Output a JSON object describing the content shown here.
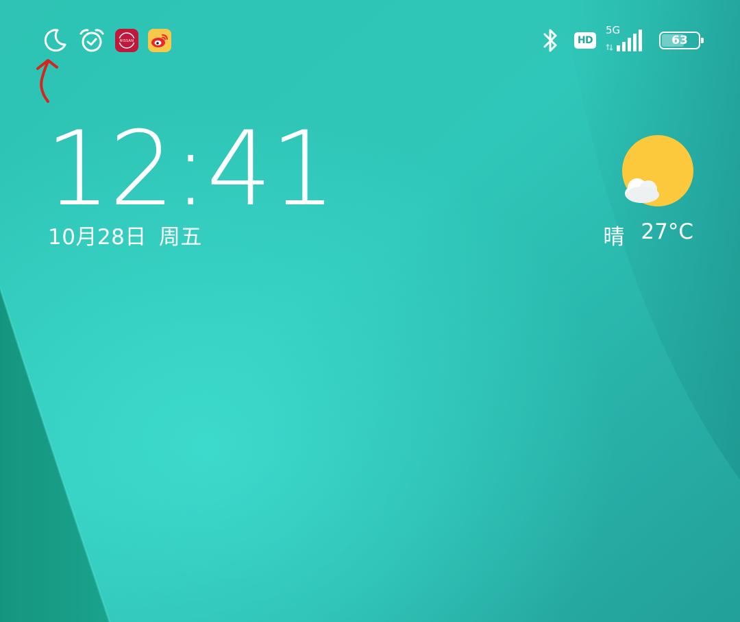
{
  "status_bar": {
    "left_icons": [
      "moon-icon",
      "alarm-icon",
      "nissan-app-icon",
      "weibo-app-icon"
    ],
    "bluetooth": "bluetooth-icon",
    "hd_label": "HD",
    "network_label": "5G",
    "signal_level": 5,
    "battery_percent": "63"
  },
  "lockscreen": {
    "time": "12:41",
    "date": "10月28日",
    "weekday": "周五"
  },
  "weather": {
    "condition": "晴",
    "temperature": "27°C",
    "icon": "sun-cloud-icon"
  },
  "colors": {
    "wallpaper_main": "#2bbcb0",
    "wallpaper_dark": "#1a9d8a",
    "sun": "#fdc93c",
    "annotation": "#d4261c"
  }
}
